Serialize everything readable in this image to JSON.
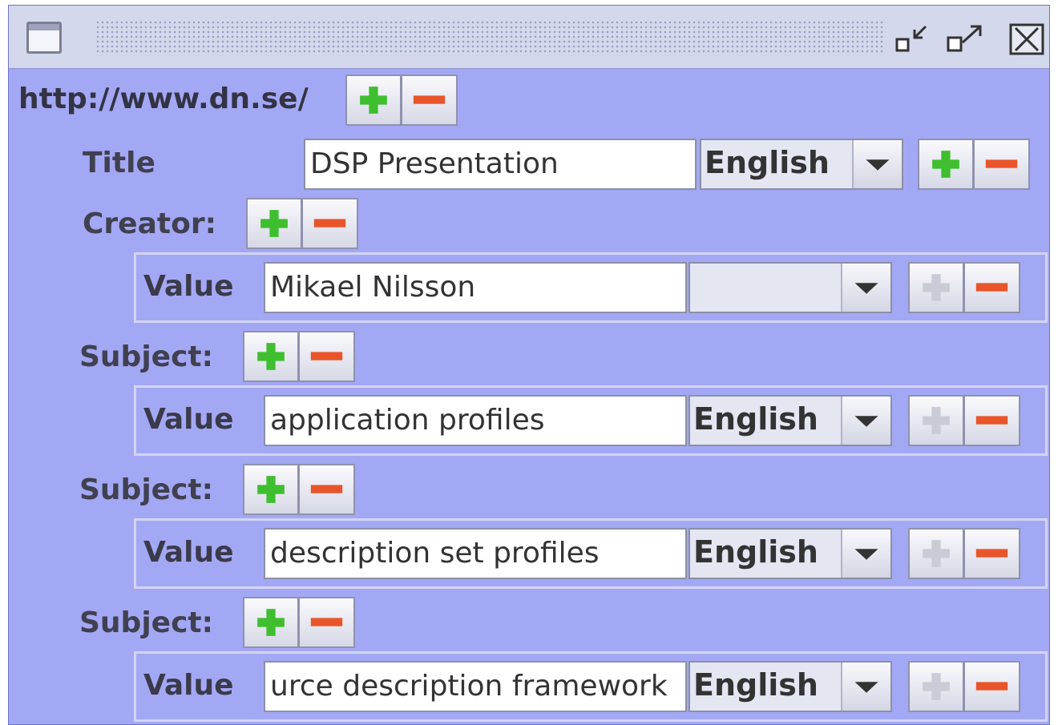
{
  "window": {
    "icons": [
      "window-icon",
      "minimize-icon",
      "maximize-icon",
      "close-icon"
    ]
  },
  "resource": {
    "url": "http://www.dn.se/"
  },
  "title_row": {
    "label": "Title",
    "value": "DSP Presentation",
    "language": "English"
  },
  "creator": {
    "label": "Creator:",
    "value_label": "Value",
    "value": "Mikael Nilsson",
    "language": ""
  },
  "subjects": [
    {
      "label": "Subject:",
      "value_label": "Value",
      "value": "application profiles",
      "language": "English"
    },
    {
      "label": "Subject:",
      "value_label": "Value",
      "value": "description set profiles",
      "language": "English"
    },
    {
      "label": "Subject:",
      "value_label": "Value",
      "value": "urce description framework",
      "language": "English"
    }
  ],
  "colors": {
    "panel_bg": "#a3a8f5",
    "plus_green": "#3fbf2f",
    "minus_red": "#e8552a",
    "plus_disabled": "#c9cbd6"
  }
}
